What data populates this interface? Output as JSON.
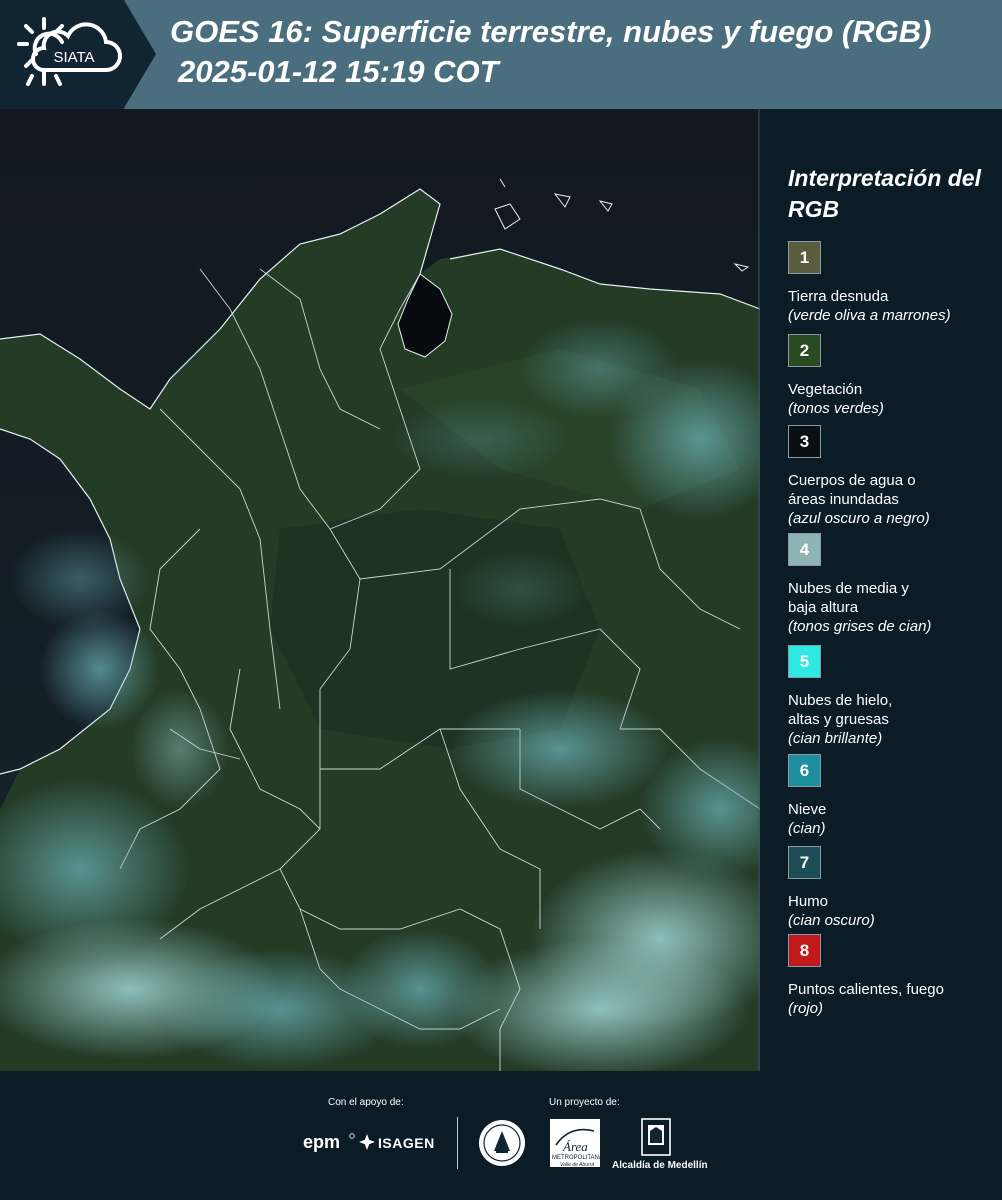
{
  "header": {
    "logo_text": "SIATA",
    "title_line1": "GOES 16: Superficie terrestre, nubes y fuego (RGB)",
    "title_line2": "2025-01-12 15:19 COT"
  },
  "legend": {
    "title": "Interpretación del RGB",
    "items": [
      {
        "number": "1",
        "label": "Tierra desnuda",
        "sub": "(verde oliva a marrones)",
        "color": "#5b5c3e"
      },
      {
        "number": "2",
        "label": "Vegetación",
        "sub": "(tonos verdes)",
        "color": "#2c4a22"
      },
      {
        "number": "3",
        "label": "Cuerpos de agua o áreas inundadas",
        "sub": "(azul oscuro a negro)",
        "color": "#0a0f14"
      },
      {
        "number": "4",
        "label": "Nubes de media y baja altura",
        "sub": "(tonos grises de cian)",
        "color": "#8fb4b6"
      },
      {
        "number": "5",
        "label": "Nubes de hielo, altas y gruesas",
        "sub": "(cian brillante)",
        "color": "#2ee8e4"
      },
      {
        "number": "6",
        "label": "Nieve",
        "sub": "(cian)",
        "color": "#1d8ea0"
      },
      {
        "number": "7",
        "label": "Humo",
        "sub": "(cian oscuro)",
        "color": "#1d4e55"
      },
      {
        "number": "8",
        "label": "Puntos calientes, fuego",
        "sub": "(rojo)",
        "color": "#c0191c"
      }
    ]
  },
  "footer": {
    "support_label": "Con el apoyo de:",
    "project_label": "Un proyecto de:",
    "epm": "epm",
    "isagen": "ISAGEN",
    "metro_title": "Área",
    "metro_sub": "METROPOLITANA",
    "metro_sub2": "Valle de Aburrá",
    "alcaldia": "Alcaldía de Medellín"
  }
}
